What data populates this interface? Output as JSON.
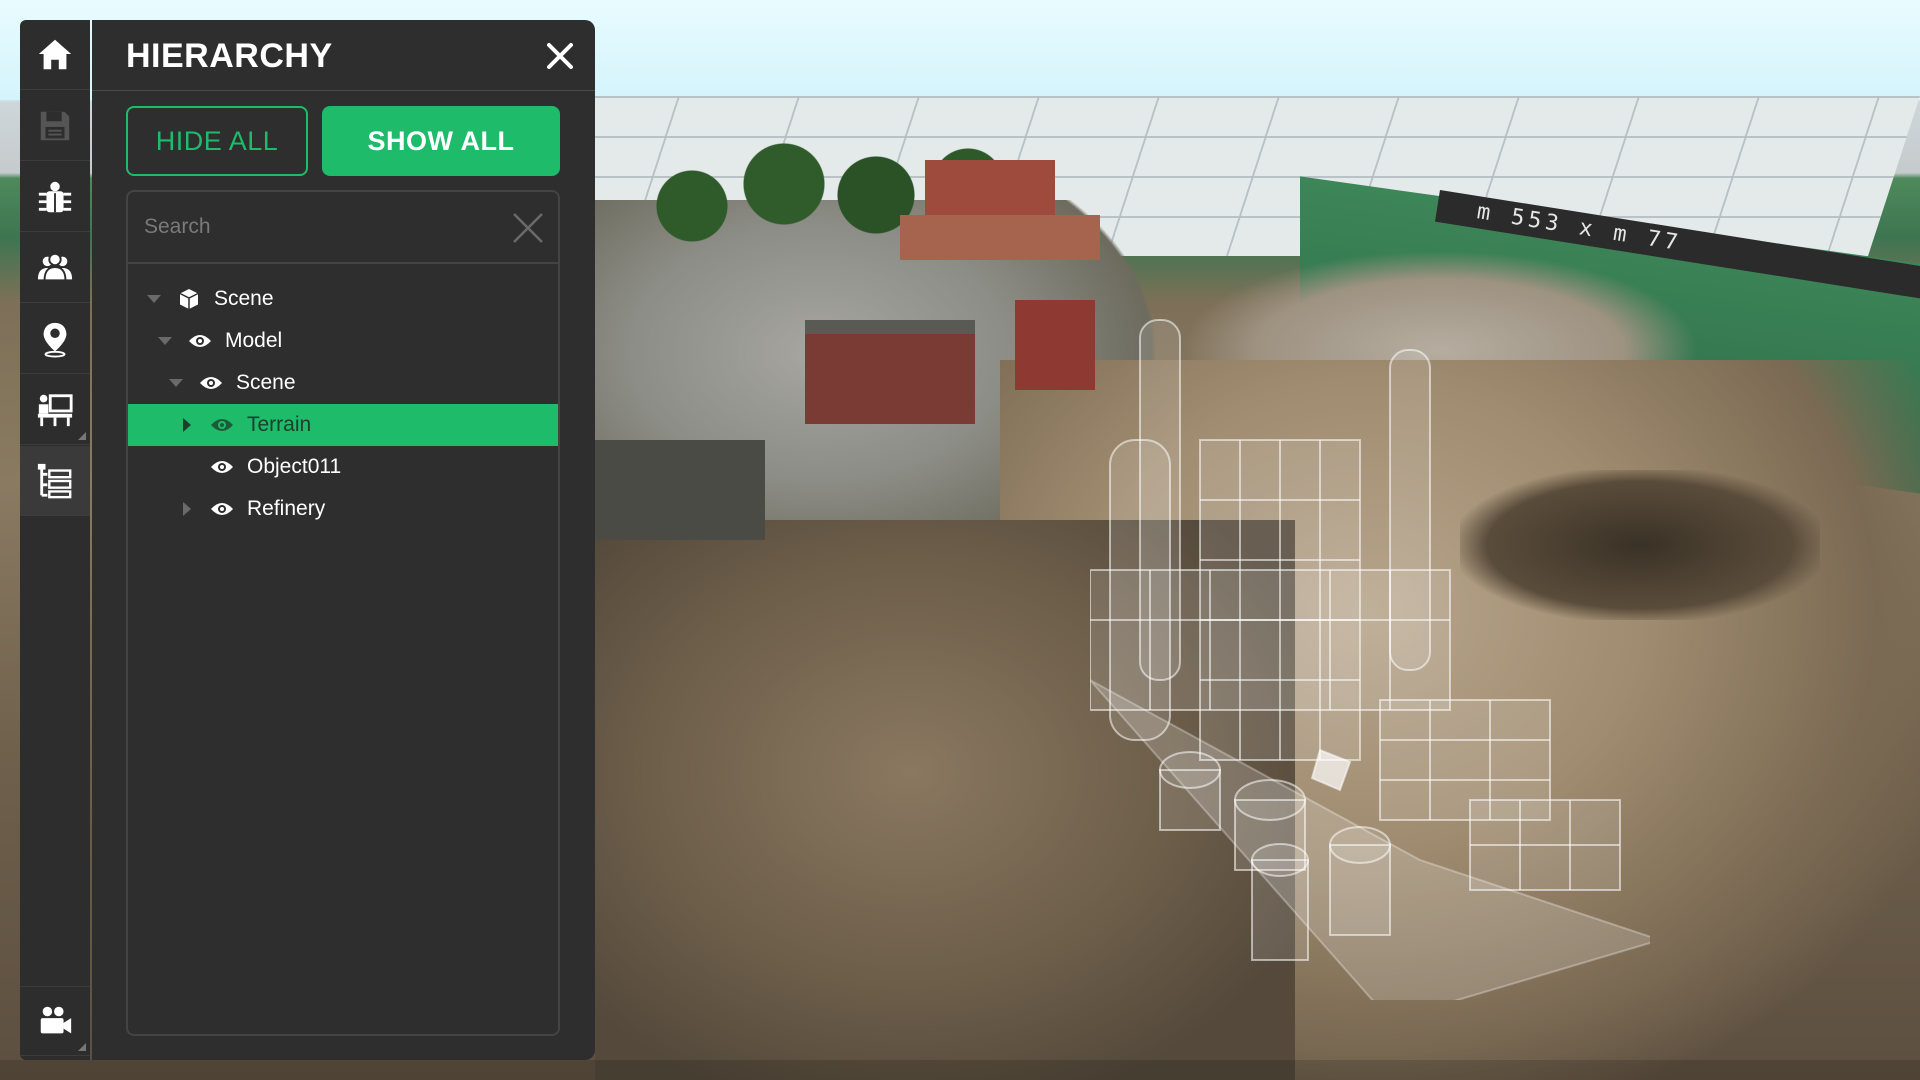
{
  "panel": {
    "title": "HIERARCHY",
    "hide_all_label": "HIDE ALL",
    "show_all_label": "SHOW ALL",
    "search_placeholder": "Search"
  },
  "tree": [
    {
      "label": "Scene",
      "depth": 0,
      "expanded": true,
      "icon": "cube-icon",
      "selected": false
    },
    {
      "label": "Model",
      "depth": 1,
      "expanded": true,
      "icon": "eye-icon",
      "selected": false
    },
    {
      "label": "Scene",
      "depth": 2,
      "expanded": true,
      "icon": "eye-icon",
      "selected": false
    },
    {
      "label": "Terrain",
      "depth": 3,
      "expanded": false,
      "icon": "eye-icon",
      "selected": true
    },
    {
      "label": "Object011",
      "depth": 3,
      "expanded": null,
      "icon": "eye-icon",
      "selected": false
    },
    {
      "label": "Refinery",
      "depth": 3,
      "expanded": false,
      "icon": "eye-icon",
      "selected": false
    }
  ],
  "toolbar": {
    "items": [
      "home-icon",
      "save-icon",
      "bug-icon",
      "users-icon",
      "location-pin-icon",
      "presentation-icon",
      "hierarchy-list-icon",
      "video-camera-icon"
    ],
    "active": "hierarchy-list-icon"
  },
  "scene": {
    "scale_label": "m 553 x m 77"
  },
  "colors": {
    "accent": "#1dbb6a",
    "panel_bg": "#2e2e2e",
    "toolbar_bg": "#2d2d2d"
  }
}
